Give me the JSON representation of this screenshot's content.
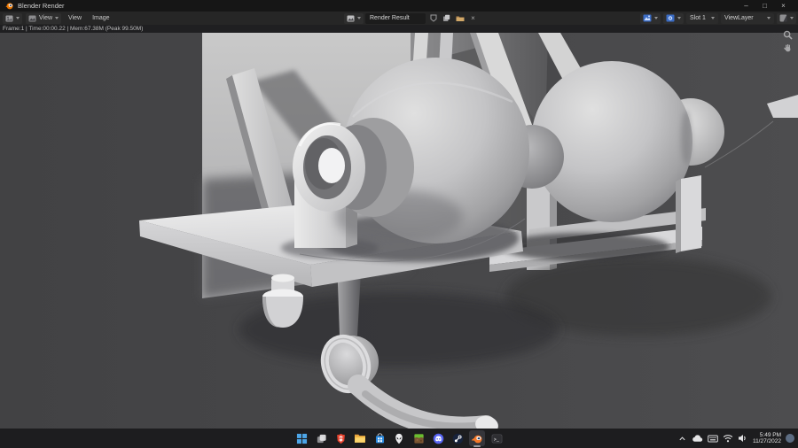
{
  "window": {
    "title": "Blender Render",
    "minimize": "–",
    "maximize": "□",
    "close": "×"
  },
  "header": {
    "mode_label": "View",
    "menus": [
      {
        "label": "View"
      },
      {
        "label": "Image"
      }
    ],
    "image_name": "Render Result",
    "unlink_glyph": "×",
    "slot": "Slot 1",
    "view_layer": "ViewLayer"
  },
  "info_bar": {
    "text": "Frame:1 | Time:00:00.22 | Mem:67.38M (Peak 99.50M)"
  },
  "scene": {
    "colors": {
      "viewport_background": "#4a4a4c",
      "wall": "#c2c2c4",
      "model_clay": "#d6d6d8",
      "shadow": "#2e2e30"
    }
  },
  "taskbar": {
    "icons": [
      {
        "name": "start"
      },
      {
        "name": "task-view"
      },
      {
        "name": "brave"
      },
      {
        "name": "file-explorer"
      },
      {
        "name": "microsoft-store"
      },
      {
        "name": "alienware"
      },
      {
        "name": "minecraft"
      },
      {
        "name": "discord"
      },
      {
        "name": "steam"
      },
      {
        "name": "blender",
        "active": true
      },
      {
        "name": "terminal"
      }
    ],
    "terminal_glyph": ">_",
    "tray_icons": [
      "chevron-up",
      "onedrive",
      "touch-keyboard",
      "wifi",
      "volume"
    ],
    "clock": {
      "time": "5:49 PM",
      "date": "11/27/2022"
    }
  }
}
